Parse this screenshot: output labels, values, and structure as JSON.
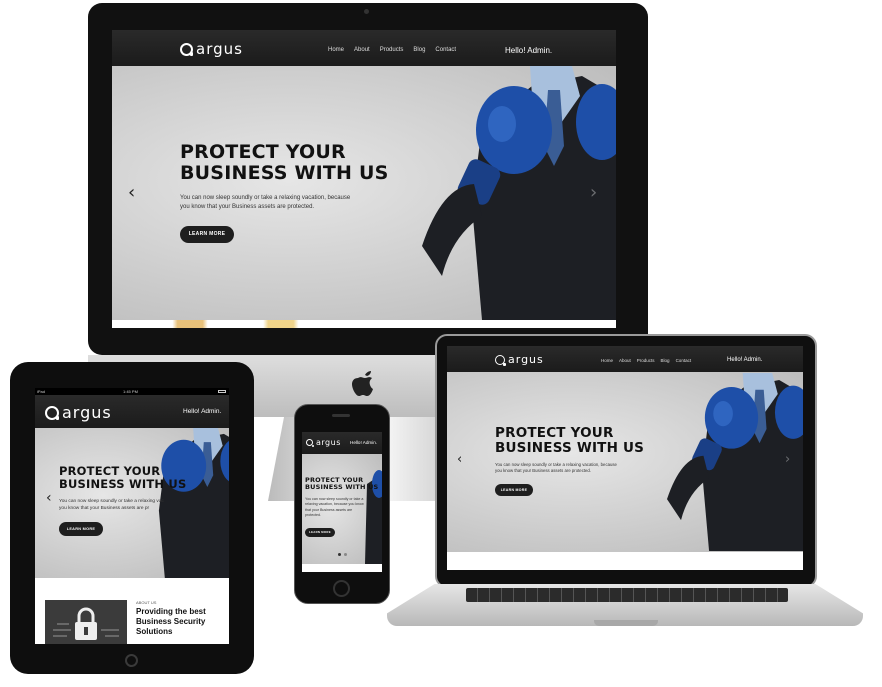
{
  "site": {
    "logo_text": "argus",
    "nav_items": [
      "Home",
      "About",
      "Products",
      "Blog",
      "Contact"
    ],
    "greeting": "Hello! Admin.",
    "greeting_tablet": "Hello! Admin.",
    "greeting_phone": "Hello! Admin."
  },
  "hero": {
    "headline_line1": "PROTECT YOUR",
    "headline_line2": "BUSINESS WITH US",
    "description_line1": "You can now sleep soundly or take a relaxing vacation, because",
    "description_line2": "you know that your Business assets are protected.",
    "tablet_description_line1": "You can now sleep soundly or take a relaxing vac",
    "tablet_description_line2": "you know that your Business assets are pr",
    "phone_description_line1": "You can now sleep soundly or take a",
    "phone_description_line2": "relaxing vacation, because you know",
    "phone_description_line3": "that your Business assets are",
    "phone_description_line4": "protected.",
    "cta_label": "LEARN MORE",
    "prev_icon": "chevron-left-icon",
    "next_icon": "chevron-right-icon"
  },
  "about": {
    "section_label": "ABOUT US",
    "title_line1": "Providing the best",
    "title_line2": "Business Security",
    "title_line3": "Solutions"
  },
  "tablet_status": {
    "carrier": "iPad",
    "time": "1:45 PM"
  },
  "devices": [
    "imac",
    "laptop",
    "tablet",
    "phone"
  ],
  "colors": {
    "nav_bg": "#222222",
    "hero_bg": "#d4d4d4",
    "button_bg": "#1e1e1e",
    "glove_blue": "#1e4fa8"
  }
}
